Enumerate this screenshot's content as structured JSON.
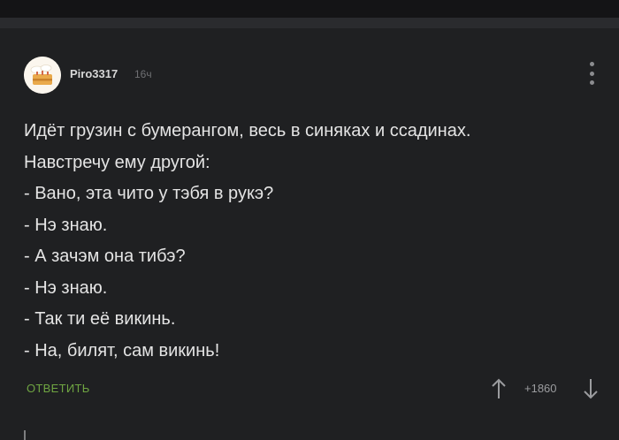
{
  "comment": {
    "username": "Piro3317",
    "time": "16ч",
    "avatar_icon": "cake-icon",
    "lines": [
      "Идёт грузин с бумерангом, весь в синяках и ссадинах.",
      "Навстречу ему другой:",
      "- Вано, эта чито у тэбя в рукэ?",
      "- Нэ знаю.",
      "- А зачэм она тибэ?",
      "- Нэ знаю.",
      "- Так ти её викинь.",
      "- На, билят, сам викинь!"
    ]
  },
  "actions": {
    "reply_label": "ОТВЕТИТЬ",
    "rating": "+1860",
    "upvote_icon": "arrow-up-icon",
    "downvote_icon": "arrow-down-icon",
    "menu_icon": "more-vertical-icon"
  },
  "colors": {
    "background": "#1f2022",
    "text": "#e4e4e4",
    "reply_green": "#6fa542",
    "muted": "#6f7073"
  }
}
